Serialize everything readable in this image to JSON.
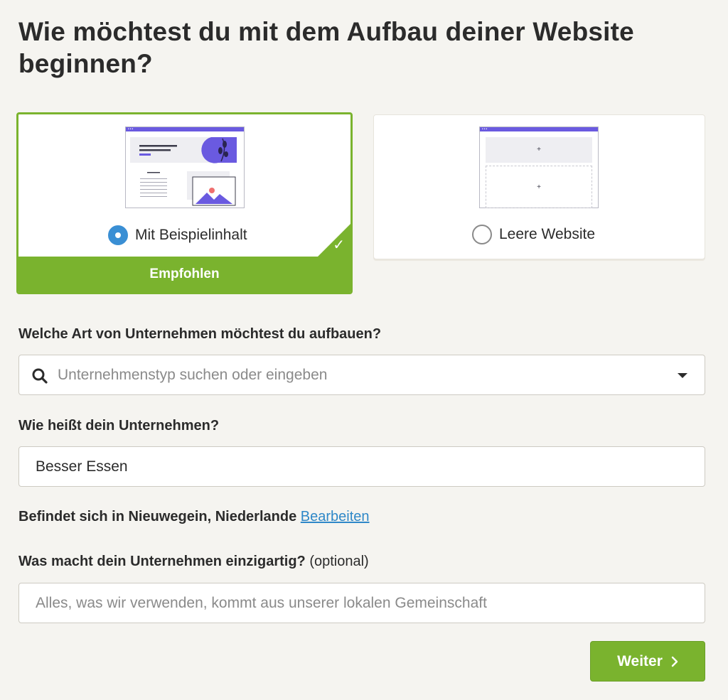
{
  "page": {
    "title": "Wie möchtest du mit dem Aufbau deiner Website beginnen?"
  },
  "options": {
    "sample": {
      "label": "Mit Beispielinhalt",
      "badge": "Empfohlen",
      "selected": true
    },
    "empty": {
      "label": "Leere Website",
      "selected": false,
      "plus": "+"
    }
  },
  "form": {
    "business_type": {
      "label": "Welche Art von Unternehmen möchtest du aufbauen?",
      "placeholder": "Unternehmenstyp suchen oder eingeben"
    },
    "business_name": {
      "label": "Wie heißt dein Unternehmen?",
      "value": "Besser Essen"
    },
    "location": {
      "text": "Befindet sich in Nieuwegein, Niederlande",
      "edit_link": "Bearbeiten"
    },
    "unique": {
      "label": "Was macht dein Unternehmen einzigartig?",
      "optional": "(optional)",
      "placeholder": "Alles, was wir verwenden, kommt aus unserer lokalen Gemeinschaft"
    },
    "next_button": "Weiter"
  },
  "colors": {
    "accent_green": "#7ab32e",
    "radio_blue": "#3a8fd4",
    "link_blue": "#2f88c8",
    "thumb_purple": "#6a5ae0",
    "background": "#f5f4f0"
  },
  "icons": {
    "search": "search-icon",
    "dropdown": "caret-down-icon",
    "check": "check-icon",
    "chevron": "chevron-right-icon"
  }
}
